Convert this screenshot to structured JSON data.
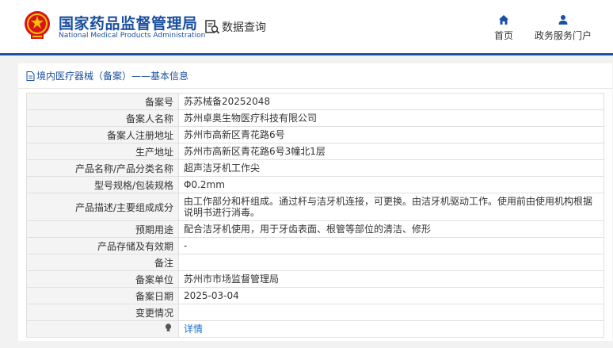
{
  "header": {
    "org_name_cn": "国家药品监督管理局",
    "org_name_en": "National Medical Products Administration",
    "query_label": "数据查询",
    "nav": [
      {
        "label": "首页",
        "icon": "home-icon"
      },
      {
        "label": "政务服务门户",
        "icon": "user-icon"
      }
    ]
  },
  "colors": {
    "brand": "#1a4f9f",
    "logo_red": "#d7141a",
    "link": "#1a6fd1"
  },
  "panel": {
    "title": "境内医疗器械（备案）——基本信息"
  },
  "rows": [
    {
      "label": "备案号",
      "value": "苏苏械备20252048"
    },
    {
      "label": "备案人名称",
      "value": "苏州卓奥生物医疗科技有限公司"
    },
    {
      "label": "备案人注册地址",
      "value": "苏州市高新区青花路6号"
    },
    {
      "label": "生产地址",
      "value": "苏州市高新区青花路6号3幢北1层"
    },
    {
      "label": "产品名称/产品分类名称",
      "value": "超声洁牙机工作尖"
    },
    {
      "label": "型号规格/包装规格",
      "value": "Φ0.2mm"
    },
    {
      "label": "产品描述/主要组成成分",
      "value": "由工作部分和杆组成。通过杆与洁牙机连接，可更换。由洁牙机驱动工作。使用前由使用机构根据说明书进行消毒。"
    },
    {
      "label": "预期用途",
      "value": "配合洁牙机使用，用于牙齿表面、根管等部位的清洁、修形"
    },
    {
      "label": "产品存储及有效期",
      "value": "-"
    },
    {
      "label": "备注",
      "value": ""
    },
    {
      "label": "备案单位",
      "value": "苏州市市场监督管理局"
    },
    {
      "label": "备案日期",
      "value": "2025-03-04"
    },
    {
      "label": "变更情况",
      "value": ""
    }
  ],
  "detail_link": "详情"
}
